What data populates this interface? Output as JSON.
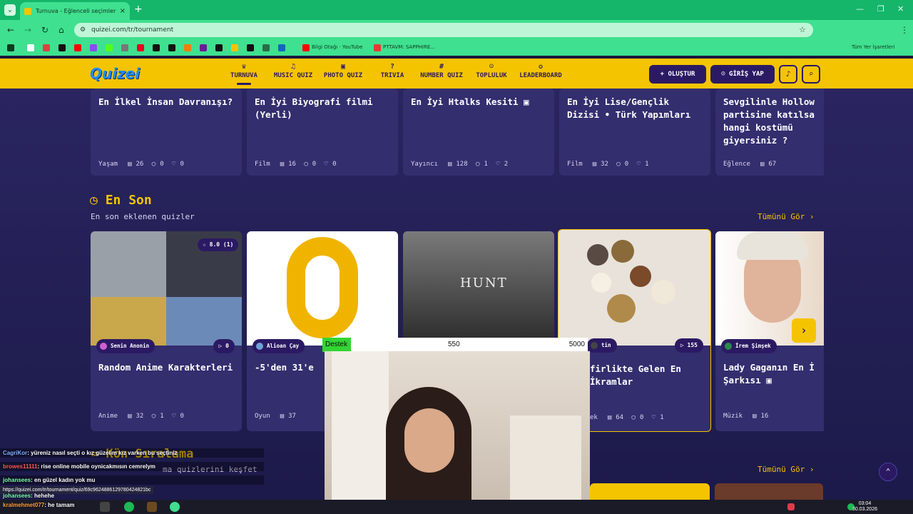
{
  "browser": {
    "tab_title": "Turnuva - Eğlenceli seçimler ya",
    "url": "quizei.com/tr/tournament",
    "bookmarks": [
      "Bilgi Otağı · YouTube",
      "PTTAVM: SAPPHIRE...",
      "Tüm Yer İşaretleri"
    ]
  },
  "header": {
    "logo": "Quizei",
    "nav": [
      {
        "label": "TURNUVA",
        "icon": "trophy-icon"
      },
      {
        "label": "MUSIC QUIZ",
        "icon": "music-note-icon"
      },
      {
        "label": "PHOTO QUIZ",
        "icon": "camera-icon"
      },
      {
        "label": "TRIVIA",
        "icon": "question-icon"
      },
      {
        "label": "NUMBER QUIZ",
        "icon": "hash-icon"
      },
      {
        "label": "TOPLULUK",
        "icon": "users-icon"
      },
      {
        "label": "LEADERBOARD",
        "icon": "medal-icon"
      }
    ],
    "create_label": "+ OLUŞTUR",
    "login_label": "GİRİŞ YAP"
  },
  "top_cards": [
    {
      "title": "En İlkel İnsan Davranışı?",
      "category": "Yaşam",
      "count": "26",
      "comments": "0",
      "likes": "0"
    },
    {
      "title": "En İyi Biyografi filmi (Yerli)",
      "category": "Film",
      "count": "16",
      "comments": "0",
      "likes": "0"
    },
    {
      "title": "En İyi Htalks Kesiti ▣",
      "category": "Yayıncı",
      "count": "128",
      "comments": "1",
      "likes": "2"
    },
    {
      "title": "En İyi Lise/Gençlik Dizisi • Türk Yapımları",
      "category": "Film",
      "count": "32",
      "comments": "0",
      "likes": "1"
    },
    {
      "title": "Sevgilinle Hollow partisine katılsa hangi kostümü giyersiniz ?",
      "category": "Eğlence",
      "count": "67",
      "comments": "",
      "likes": ""
    }
  ],
  "latest": {
    "title": "En Son",
    "subtitle": "En son eklenen quizler",
    "see_all": "Tümünü Gör ›",
    "cards": [
      {
        "title": "Random Anime Karakterleri",
        "author": "Senin Anonin",
        "plays": "0",
        "rating": "☆ 8.0 (1)",
        "category": "Anime",
        "count": "32",
        "comments": "1",
        "likes": "0"
      },
      {
        "title": "-5'den 31'e",
        "author": "Alioan Çay",
        "plays": "",
        "rating": "",
        "category": "Oyun",
        "count": "37",
        "comments": "",
        "likes": ""
      },
      {
        "title": "",
        "author": "",
        "plays": "",
        "rating": "",
        "category": "",
        "count": "",
        "comments": "",
        "likes": ""
      },
      {
        "title": "firlikte Gelen En İkramlar",
        "author": "tin",
        "plays": "155",
        "rating": "",
        "category": "ek",
        "count": "64",
        "comments": "0",
        "likes": "1"
      },
      {
        "title": "Lady Gaganın En İ Şarkısı ▣",
        "author": "İrem Şimşek",
        "plays": "",
        "rating": "",
        "category": "Müzik",
        "count": "16",
        "comments": "",
        "likes": ""
      }
    ]
  },
  "next_section": {
    "title": "Kön Sıralama",
    "subtitle": "ma quizlerini keşfet",
    "see_all": "Tümünü Gör ›"
  },
  "stream": {
    "destek_label": "Destek",
    "destek_mid": "550",
    "destek_max": "5000",
    "chat": [
      {
        "user": "CagriKor",
        "text": ": yüreniz nasıl seçti o kız güzelim kız varken bu seçtiniz",
        "color": "#7fb0ff"
      },
      {
        "user": "browes11111",
        "text": ": rise online mobile oynicakmısın cemrelym",
        "color": "#ff5c5c"
      },
      {
        "user": "johansees",
        "text": ": en güzel kadın yok mu",
        "color": "#7fffaf"
      },
      {
        "user": "johansees",
        "text": ": hehehe",
        "color": "#7fffaf"
      },
      {
        "user": "kralmehmet077",
        "text": ": he tamam",
        "color": "#ff9f40"
      }
    ],
    "status_url": "https://quizei.com/tr/tournament/quiz/69c9624886129780424821bc"
  },
  "taskbar": {
    "time": "03:04",
    "date": "30.03.2026"
  },
  "colors": {
    "accent": "#f5c400",
    "navy": "#2b1a63",
    "bg": "#1c1a4a"
  }
}
